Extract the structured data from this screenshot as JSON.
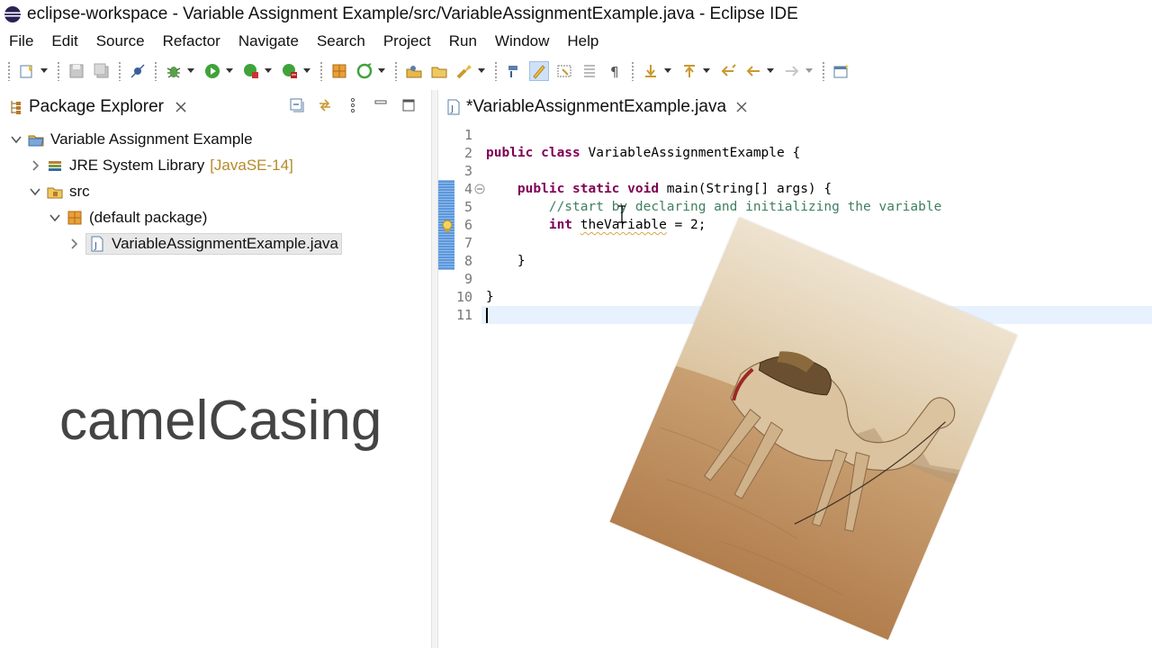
{
  "window": {
    "title": "eclipse-workspace - Variable Assignment Example/src/VariableAssignmentExample.java - Eclipse IDE"
  },
  "menu": [
    "File",
    "Edit",
    "Source",
    "Refactor",
    "Navigate",
    "Search",
    "Project",
    "Run",
    "Window",
    "Help"
  ],
  "package_explorer": {
    "tab_label": "Package Explorer",
    "tree": [
      {
        "label": "Variable Assignment Example",
        "deco": "",
        "icon": "project-icon",
        "expanded": true,
        "depth": 0
      },
      {
        "label": "JRE System Library",
        "deco": "[JavaSE-14]",
        "icon": "library-icon",
        "expanded": false,
        "depth": 1
      },
      {
        "label": "src",
        "deco": "",
        "icon": "source-folder-icon",
        "expanded": true,
        "depth": 1
      },
      {
        "label": "(default package)",
        "deco": "",
        "icon": "package-icon",
        "expanded": true,
        "depth": 2
      },
      {
        "label": "VariableAssignmentExample.java",
        "deco": "",
        "icon": "java-file-icon",
        "expanded": false,
        "depth": 3,
        "selected": true
      }
    ]
  },
  "overlay_caption": "camelCasing",
  "editor": {
    "tab_label": "*VariableAssignmentExample.java",
    "line_numbers": [
      "1",
      "2",
      "3",
      "4",
      "5",
      "6",
      "7",
      "8",
      "9",
      "10",
      "11"
    ],
    "code": {
      "l2_kw": "public class",
      "l2_rest": " VariableAssignmentExample {",
      "l4_indent": "    ",
      "l4_kw": "public static void",
      "l4_rest": " main(String[] args) {",
      "l5_indent": "        ",
      "l5_comment": "//start by declaring and initializing the variable",
      "l6_indent": "        ",
      "l6_kw": "int",
      "l6_space": " ",
      "l6_var": "theVariable",
      "l6_rest": " = 2;",
      "l8": "    }",
      "l10": "}"
    },
    "current_line": 11
  },
  "colors": {
    "keyword": "#7f0055",
    "comment": "#3f7f5f",
    "decoration": "#b58a2a",
    "marker": "#3f86d6"
  },
  "photo": {
    "subject": "camel-photo"
  }
}
